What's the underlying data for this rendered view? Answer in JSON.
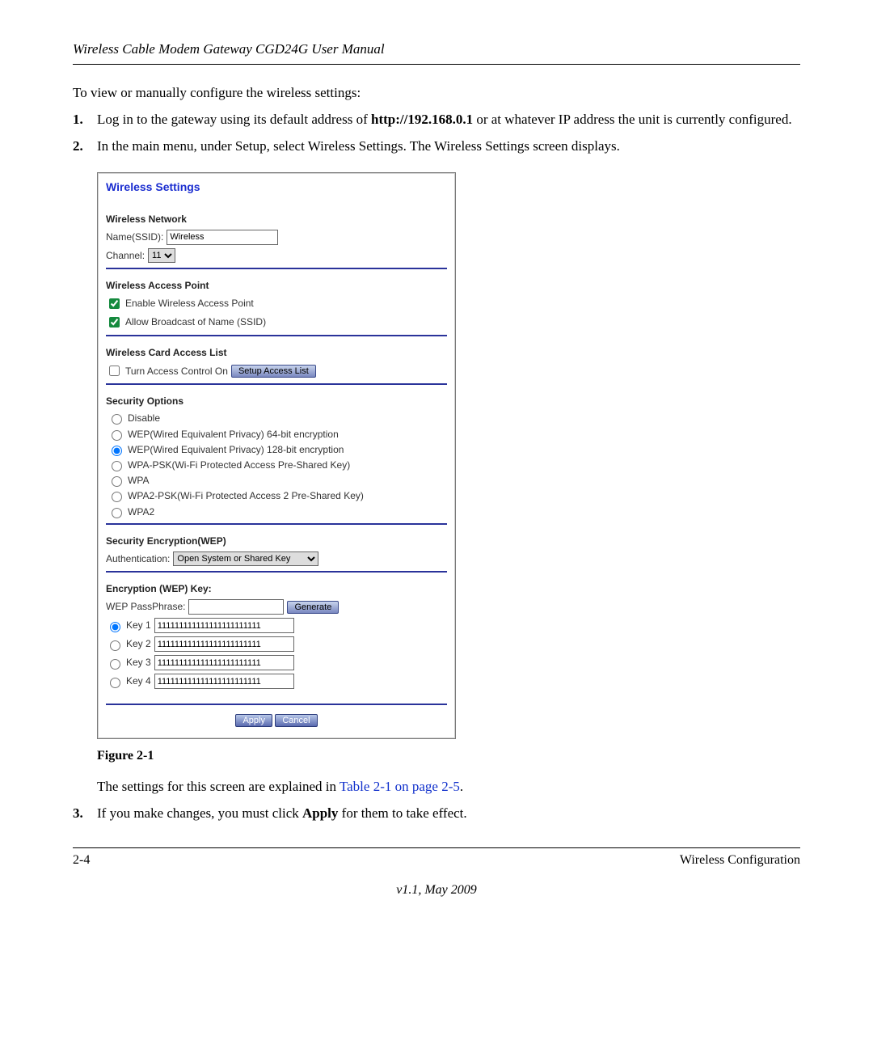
{
  "header": {
    "title": "Wireless Cable Modem Gateway CGD24G User Manual"
  },
  "intro": "To view or manually configure the wireless settings:",
  "steps": {
    "s1_num": "1.",
    "s1a": "Log in to the gateway using its default address of ",
    "s1_url": "http://192.168.0.1",
    "s1b": " or at whatever IP address the unit is currently configured.",
    "s2_num": "2.",
    "s2": "In the main menu, under Setup, select Wireless Settings. The Wireless Settings screen displays.",
    "s3_num": "3.",
    "s3a": "If you make changes, you must click ",
    "s3_apply": "Apply",
    "s3b": " for them to take effect."
  },
  "panel": {
    "title": "Wireless Settings",
    "net_head": "Wireless Network",
    "ssid_label": "Name(SSID):",
    "ssid_value": "Wireless",
    "channel_label": "Channel:",
    "channel_value": "11",
    "ap_head": "Wireless Access Point",
    "ap_enable": "Enable Wireless Access Point",
    "ap_broadcast": "Allow Broadcast of Name (SSID)",
    "acl_head": "Wireless Card Access List",
    "acl_turn_on": "Turn Access Control On",
    "acl_button": "Setup Access List",
    "sec_head": "Security Options",
    "sec_opts": [
      "Disable",
      "WEP(Wired Equivalent Privacy) 64-bit encryption",
      "WEP(Wired Equivalent Privacy) 128-bit encryption",
      "WPA-PSK(Wi-Fi Protected Access Pre-Shared Key)",
      "WPA",
      "WPA2-PSK(Wi-Fi Protected Access 2 Pre-Shared Key)",
      "WPA2"
    ],
    "wep_head": "Security Encryption(WEP)",
    "auth_label": "Authentication:",
    "auth_value": "Open System or Shared Key",
    "key_head": "Encryption (WEP) Key:",
    "pass_label": "WEP PassPhrase:",
    "generate": "Generate",
    "keys": {
      "k1_label": "Key 1",
      "k1_val": "111111111111111111111111",
      "k2_label": "Key 2",
      "k2_val": "111111111111111111111111",
      "k3_label": "Key 3",
      "k3_val": "111111111111111111111111",
      "k4_label": "Key 4",
      "k4_val": "111111111111111111111111"
    },
    "apply": "Apply",
    "cancel": "Cancel"
  },
  "figure_caption": "Figure 2-1",
  "explain_a": "The settings for this screen are explained in ",
  "explain_link": "Table 2-1 on page 2-5",
  "explain_b": ".",
  "footer": {
    "left": "2-4",
    "right": "Wireless Configuration",
    "version": "v1.1, May 2009"
  }
}
